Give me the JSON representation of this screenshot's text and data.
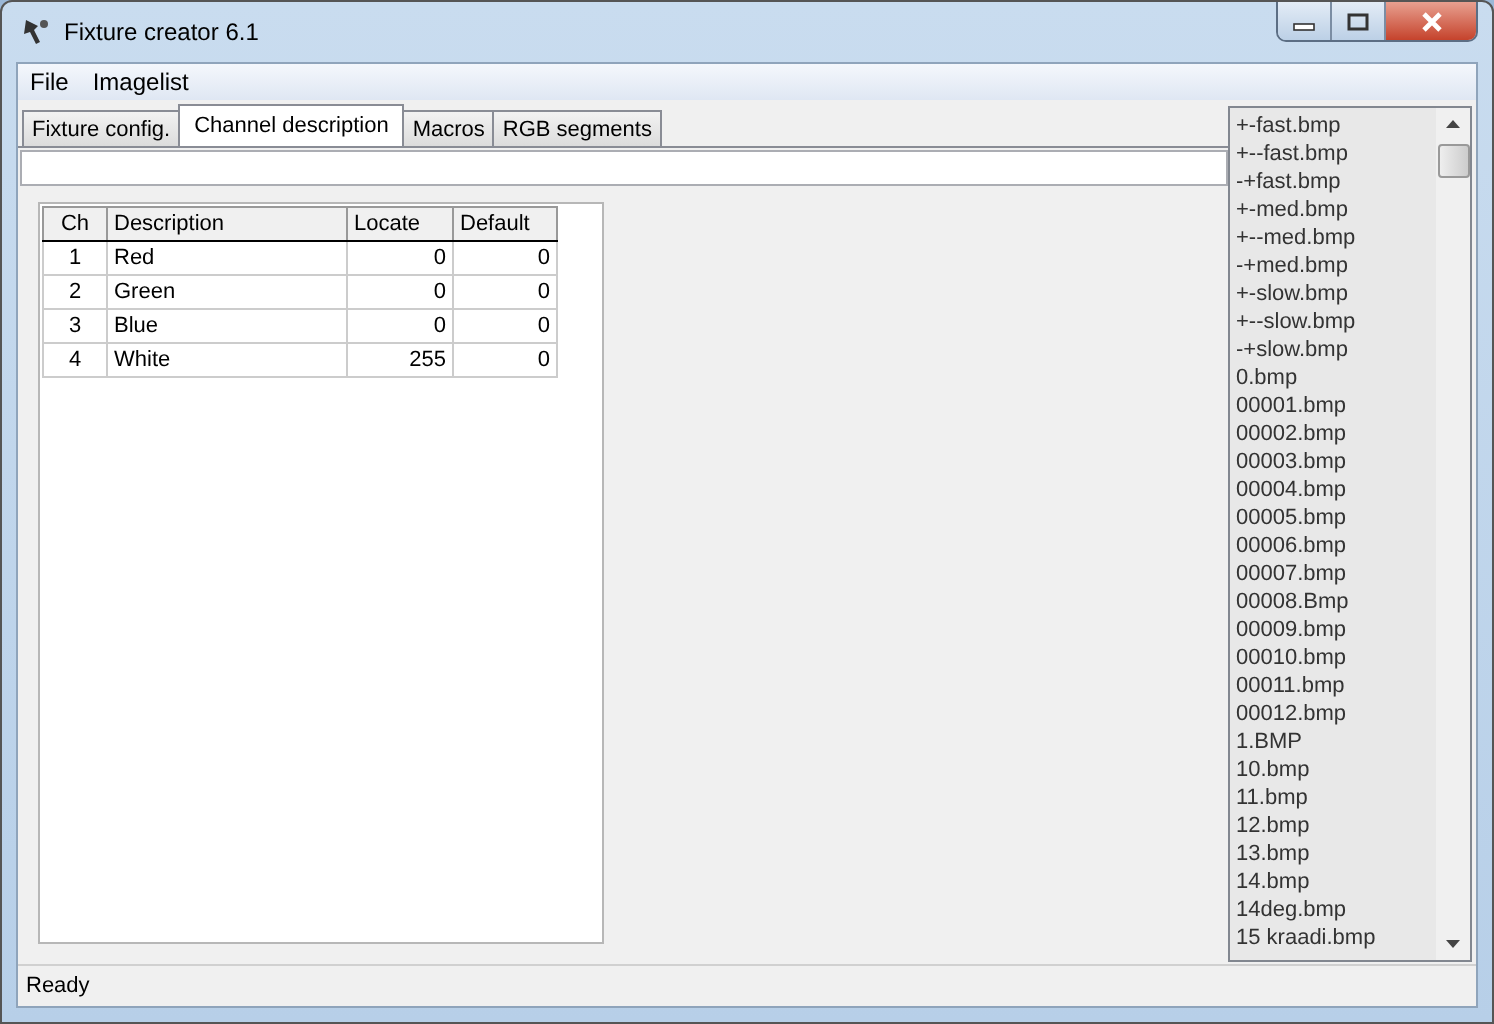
{
  "window": {
    "title": "Fixture creator 6.1"
  },
  "menu": [
    "File",
    "Imagelist"
  ],
  "tabs": [
    {
      "label": "Fixture config.",
      "selected": false
    },
    {
      "label": "Channel description",
      "selected": true
    },
    {
      "label": "Macros",
      "selected": false
    },
    {
      "label": "RGB segments",
      "selected": false
    }
  ],
  "table": {
    "columns": [
      "Ch",
      "Description",
      "Locate",
      "Default"
    ],
    "rows": [
      [
        "1",
        "Red",
        "0",
        "0"
      ],
      [
        "2",
        "Green",
        "0",
        "0"
      ],
      [
        "3",
        "Blue",
        "0",
        "0"
      ],
      [
        "4",
        "White",
        "255",
        "0"
      ]
    ]
  },
  "imagelist": [
    "+-fast.bmp",
    "+--fast.bmp",
    "-+fast.bmp",
    "+-med.bmp",
    "+--med.bmp",
    "-+med.bmp",
    "+-slow.bmp",
    "+--slow.bmp",
    "-+slow.bmp",
    "0.bmp",
    "00001.bmp",
    "00002.bmp",
    "00003.bmp",
    "00004.bmp",
    "00005.bmp",
    "00006.bmp",
    "00007.bmp",
    "00008.Bmp",
    "00009.bmp",
    "00010.bmp",
    "00011.bmp",
    "00012.bmp",
    "1.BMP",
    "10.bmp",
    "11.bmp",
    "12.bmp",
    "13.bmp",
    "14.bmp",
    "14deg.bmp",
    "15 kraadi.bmp"
  ],
  "status_bar": "Ready"
}
